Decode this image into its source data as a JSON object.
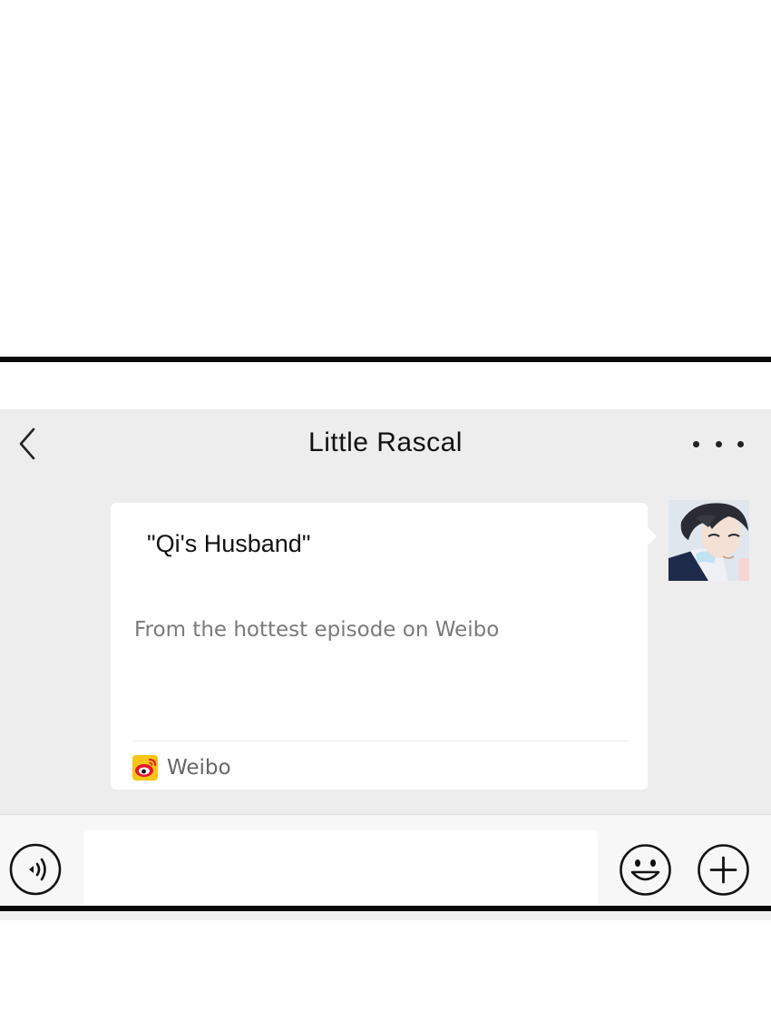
{
  "header": {
    "title": "Little Rascal",
    "back_icon": "chevron-left-icon",
    "more_icon": "more-horizontal-icon"
  },
  "message": {
    "card_title": "\"Qi's Husband\"",
    "card_description": "From the hottest episode on Weibo",
    "source_label": "Weibo",
    "source_icon": "weibo-logo-icon"
  },
  "input_bar": {
    "voice_icon": "voice-icon",
    "emoji_icon": "smiley-icon",
    "plus_icon": "plus-circle-icon",
    "input_value": ""
  },
  "colors": {
    "nav_background": "#ededed",
    "chat_background": "#ededed",
    "card_background": "#ffffff",
    "input_bar_background": "#f7f7f7",
    "weibo_yellow": "#f5c518",
    "weibo_red": "#e6162d",
    "frame_border": "#0a0a0a"
  }
}
